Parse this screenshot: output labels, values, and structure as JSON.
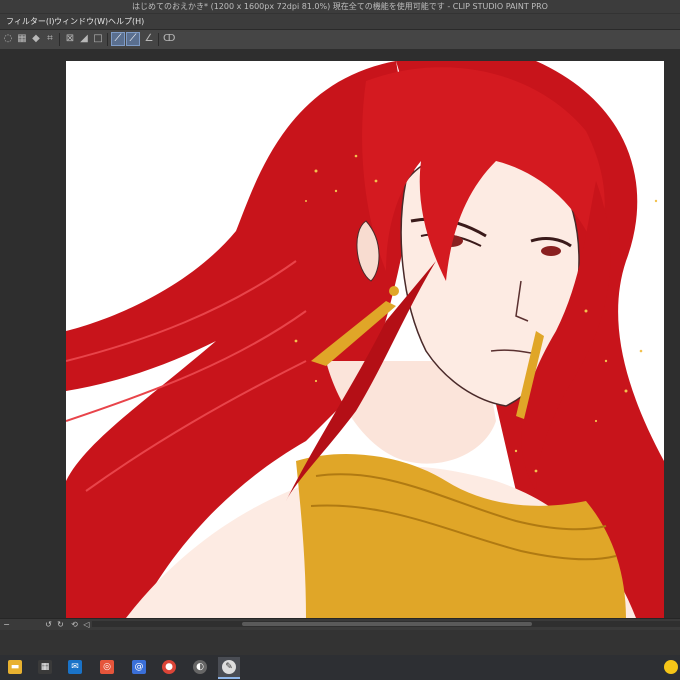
{
  "window": {
    "title": "はじめてのおえかき* (1200 x 1600px 72dpi 81.0%)  現在全ての機能を使用可能です - CLIP STUDIO PAINT PRO"
  },
  "menu": {
    "items": [
      "フィルター(I)",
      "ウィンドウ(W)",
      "ヘルプ(H)"
    ]
  },
  "toolbar": {
    "icons": [
      "lasso-icon",
      "select-icon",
      "fill-icon",
      "crop-icon",
      "transform-icon",
      "tone-icon",
      "shape-icon",
      "ruler-icon",
      "ruler-snap-icon",
      "perspective-icon",
      "spiral-icon"
    ]
  },
  "taskbar": {
    "apps": [
      "file-explorer-icon",
      "store-icon",
      "mail-icon",
      "app-icon",
      "email-icon",
      "chrome-icon",
      "clip-studio-icon",
      "clip-studio-paint-icon"
    ],
    "active": "clip-studio-paint-icon"
  },
  "colors": {
    "accent": "#7e9bc6",
    "hair": "#c8141b",
    "gold": "#e0a628"
  }
}
